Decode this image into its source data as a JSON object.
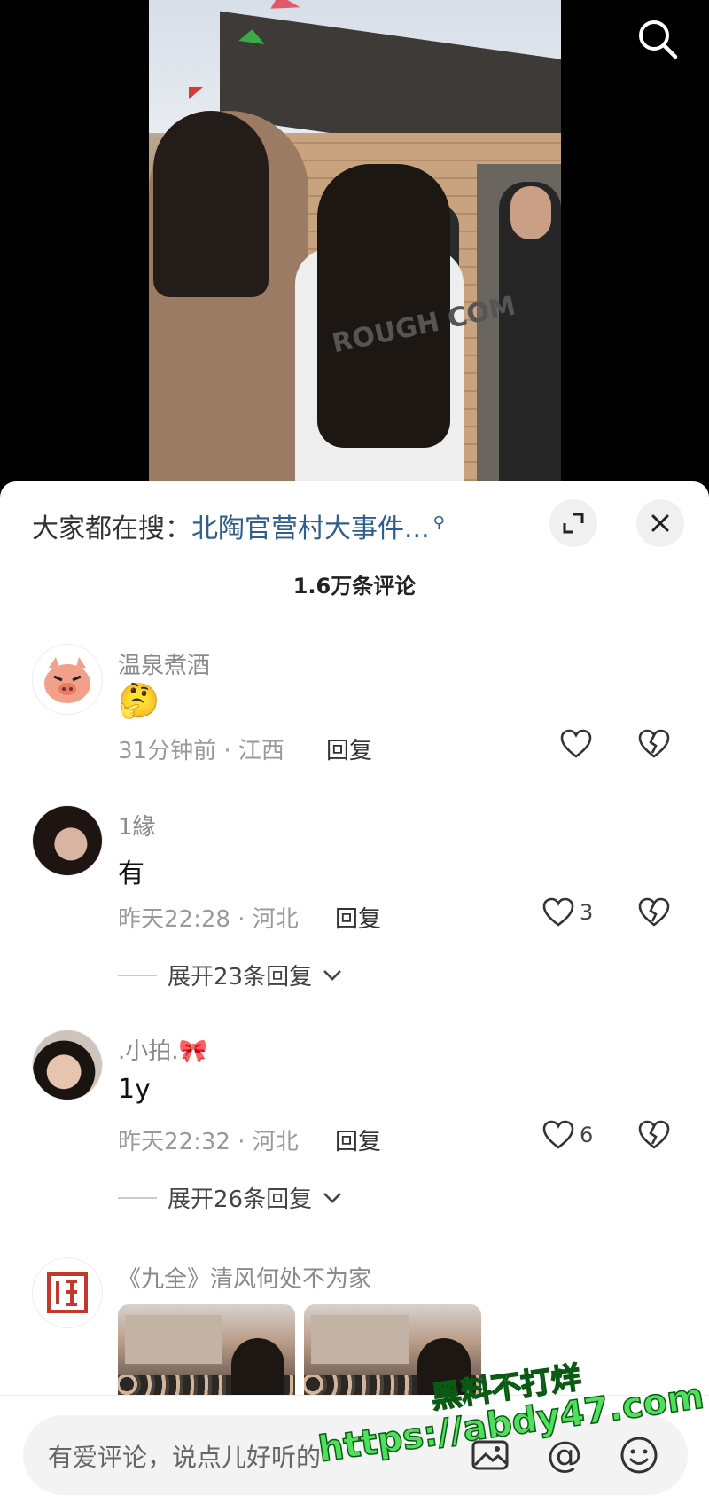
{
  "hot_search": {
    "prefix": "大家都在搜：",
    "term": "北陶官营村大事件..."
  },
  "video": {
    "jacket_text": "ROUGH COM"
  },
  "comment_count": "1.6万条评论",
  "comments": [
    {
      "username": "温泉煮酒",
      "body": "🤔",
      "meta": "31分钟前 · 江西",
      "reply": "回复",
      "likes": ""
    },
    {
      "username": "1緣",
      "body": "有",
      "meta": "昨天22:28 · 河北",
      "reply": "回复",
      "likes": "3",
      "expand": "展开23条回复"
    },
    {
      "username": ".小拍.🎀",
      "body": "1y",
      "meta": "昨天22:32 · 河北",
      "reply": "回复",
      "likes": "6",
      "expand": "展开26条回复"
    },
    {
      "username": "《九全》清风何处不为家"
    }
  ],
  "input": {
    "placeholder": "有爱评论，说点儿好听的",
    "at": "@"
  },
  "watermark": {
    "line1": "黑料不打烊",
    "line2": "https://abdy47.com"
  },
  "colors": {
    "link": "#2f5e8f",
    "watermark": "#4ee05a"
  }
}
